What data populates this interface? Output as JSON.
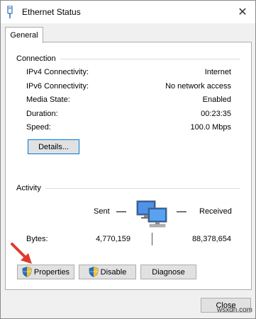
{
  "window": {
    "title": "Ethernet Status",
    "close_glyph": "✕"
  },
  "tabs": [
    {
      "label": "General"
    }
  ],
  "connection": {
    "label": "Connection",
    "rows": [
      {
        "label": "IPv4 Connectivity:",
        "value": "Internet"
      },
      {
        "label": "IPv6 Connectivity:",
        "value": "No network access"
      },
      {
        "label": "Media State:",
        "value": "Enabled"
      },
      {
        "label": "Duration:",
        "value": "00:23:35"
      },
      {
        "label": "Speed:",
        "value": "100.0 Mbps"
      }
    ],
    "details_button": "Details..."
  },
  "activity": {
    "label": "Activity",
    "sent_label": "Sent",
    "received_label": "Received",
    "bytes_label": "Bytes:",
    "bytes_sent": "4,770,159",
    "bytes_received": "88,378,654"
  },
  "buttons": {
    "properties": "Properties",
    "disable": "Disable",
    "diagnose": "Diagnose",
    "close": "Close"
  },
  "icons": {
    "title": "ethernet-adapter-icon",
    "network": "network-computers-icon",
    "shield": "uac-shield-icon",
    "annotation": "red-arrow-annotation"
  },
  "colors": {
    "accent": "#0078d7",
    "arrow": "#e03a2f"
  },
  "watermark": "wsxdn.com"
}
